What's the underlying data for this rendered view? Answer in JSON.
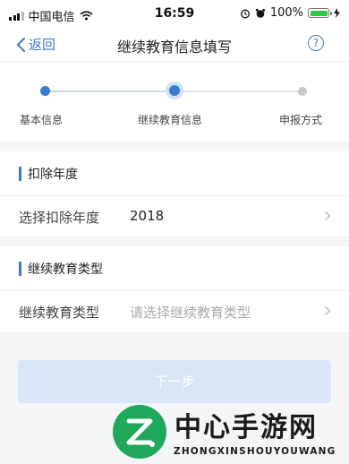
{
  "status_bar": {
    "carrier": "中国电信",
    "time": "16:59",
    "battery_pct": "100%",
    "battery_level": 1.0
  },
  "nav": {
    "back_label": "返回",
    "title": "继续教育信息填写",
    "help_glyph": "?"
  },
  "steps": [
    {
      "label": "基本信息",
      "state": "done"
    },
    {
      "label": "继续教育信息",
      "state": "current"
    },
    {
      "label": "申报方式",
      "state": "pending"
    }
  ],
  "sections": {
    "deduction_year": {
      "title": "扣除年度",
      "field_label": "选择扣除年度",
      "field_value": "2018"
    },
    "education_type": {
      "title": "继续教育类型",
      "field_label": "继续教育类型",
      "field_placeholder": "请选择继续教育类型"
    }
  },
  "next_button": {
    "label": "下一步",
    "enabled": false
  },
  "watermark": {
    "brand": "中心手游网",
    "sub": "ZHONGXINSHOUYOUWANG"
  },
  "colors": {
    "accent": "#3a7bd5",
    "step_pending": "#c8c8c8",
    "button_disabled": "#d8e6f7",
    "watermark_green": "#1ea85a"
  },
  "icons": [
    "signal-icon",
    "wifi-icon",
    "alarm-icon",
    "battery-icon",
    "back-chevron-icon",
    "help-icon",
    "chevron-right-icon",
    "watermark-logo-icon"
  ]
}
